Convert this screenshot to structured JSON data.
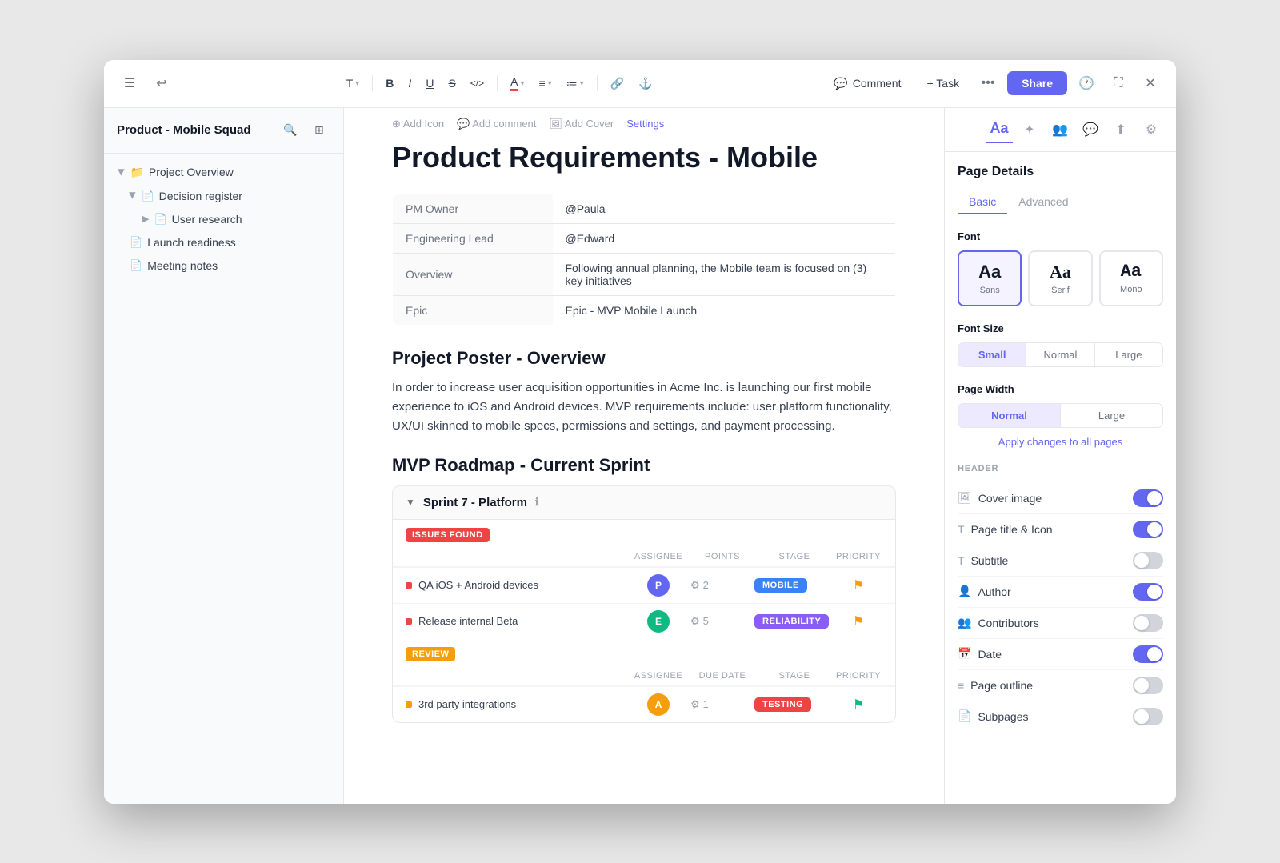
{
  "window": {
    "title": "Product - Mobile Squad"
  },
  "toolbar": {
    "undo_icon": "↩",
    "menu_icon": "☰",
    "text_type": "T",
    "bold": "B",
    "italic": "I",
    "underline": "U",
    "strikethrough": "S",
    "code": "</>",
    "color": "A",
    "align": "≡",
    "list": "≔",
    "link": "🔗",
    "anchor": "⚓",
    "comment_label": "Comment",
    "task_label": "+ Task",
    "more": "•••",
    "share_label": "Share",
    "history_icon": "🕐",
    "focus_icon": "⛶",
    "close_icon": "✕"
  },
  "sidebar": {
    "title": "Product - Mobile Squad",
    "search_icon": "🔍",
    "layout_icon": "⊞",
    "items": [
      {
        "label": "Project Overview",
        "type": "folder",
        "expanded": true,
        "indent": 0
      },
      {
        "label": "Decision register",
        "type": "doc",
        "indent": 1
      },
      {
        "label": "User research",
        "type": "doc",
        "indent": 2,
        "expandable": true
      },
      {
        "label": "Launch readiness",
        "type": "doc",
        "indent": 1
      },
      {
        "label": "Meeting notes",
        "type": "doc",
        "indent": 1
      }
    ]
  },
  "page": {
    "actions": [
      {
        "label": "Add Icon",
        "icon": "⊕"
      },
      {
        "label": "Add comment",
        "icon": "💬"
      },
      {
        "label": "Add Cover",
        "icon": "🖼"
      },
      {
        "label": "Settings",
        "icon": ""
      }
    ],
    "title": "Product Requirements - Mobile",
    "meta_rows": [
      {
        "key": "PM Owner",
        "value": "@Paula"
      },
      {
        "key": "Engineering Lead",
        "value": "@Edward"
      },
      {
        "key": "Overview",
        "value": "Following annual planning, the Mobile team is focused on (3) key initiatives"
      },
      {
        "key": "Epic",
        "value": "Epic - MVP Mobile Launch"
      }
    ],
    "section1_heading": "Project Poster - Overview",
    "section1_text": "In order to increase user acquisition opportunities in Acme Inc. is launching our first mobile experience to iOS and Android devices. MVP requirements include: user platform functionality, UX/UI skinned to mobile specs, permissions and settings, and payment processing.",
    "section2_heading": "MVP Roadmap - Current Sprint",
    "sprint": {
      "title": "Sprint  7 - Platform",
      "issues_label": "ISSUES FOUND",
      "review_label": "REVIEW",
      "columns_issues": [
        "ASSIGNEE",
        "POINTS",
        "STAGE",
        "PRIORITY"
      ],
      "columns_review": [
        "ASSIGNEE",
        "DUE DATE",
        "STAGE",
        "PRIORITY"
      ],
      "issues_tasks": [
        {
          "name": "QA iOS + Android devices",
          "dot_color": "red",
          "assignee_initial": "P",
          "assignee_color": "blue",
          "points": "2",
          "stage": "MOBILE",
          "stage_class": "stage-mobile",
          "flag_class": "flag-yellow"
        },
        {
          "name": "Release internal Beta",
          "dot_color": "red",
          "assignee_initial": "E",
          "assignee_color": "green",
          "points": "5",
          "stage": "RELIABILITY",
          "stage_class": "stage-reliability",
          "flag_class": "flag-yellow"
        }
      ],
      "review_tasks": [
        {
          "name": "3rd party integrations",
          "dot_color": "yellow",
          "assignee_initial": "A",
          "assignee_color": "orange",
          "due_date": "1",
          "stage": "TESTING",
          "stage_class": "stage-testing",
          "flag_class": "flag-green"
        }
      ]
    }
  },
  "right_panel": {
    "section_title": "Page Details",
    "tabs": [
      "Basic",
      "Advanced"
    ],
    "active_tab": "Basic",
    "font_label": "Font",
    "font_options": [
      {
        "label": "Sans",
        "preview": "Aa",
        "type": "sans",
        "selected": true
      },
      {
        "label": "Serif",
        "preview": "Aa",
        "type": "serif",
        "selected": false
      },
      {
        "label": "Mono",
        "preview": "Aa",
        "type": "mono",
        "selected": false
      }
    ],
    "font_size_label": "Font Size",
    "font_size_options": [
      "Small",
      "Normal",
      "Large"
    ],
    "font_size_selected": "Small",
    "page_width_label": "Page Width",
    "page_width_options": [
      "Normal",
      "Large"
    ],
    "page_width_selected": "Normal",
    "apply_changes_label": "Apply changes to all pages",
    "header_label": "HEADER",
    "header_items": [
      {
        "label": "Cover image",
        "icon": "🖼",
        "toggled": true
      },
      {
        "label": "Page title & Icon",
        "icon": "T",
        "toggled": true
      },
      {
        "label": "Subtitle",
        "icon": "T",
        "toggled": false
      },
      {
        "label": "Author",
        "icon": "👤",
        "toggled": true
      },
      {
        "label": "Contributors",
        "icon": "👥",
        "toggled": false
      },
      {
        "label": "Date",
        "icon": "📅",
        "toggled": true
      },
      {
        "label": "Page outline",
        "icon": "≡",
        "toggled": false
      },
      {
        "label": "Subpages",
        "icon": "📄",
        "toggled": false
      }
    ]
  }
}
